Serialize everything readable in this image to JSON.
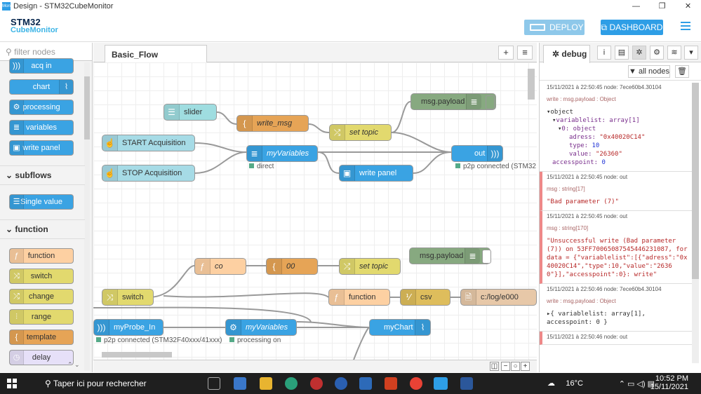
{
  "window": {
    "title": "Design - STM32CubeMonitor",
    "icon": "Mon"
  },
  "header": {
    "logo_line1": "STM32",
    "logo_line2": "CubeMonitor",
    "deploy_label": "DEPLOY",
    "dashboard_label": "DASHBOARD",
    "colors": {
      "accent": "#2e9ee6",
      "deploy_disabled": "#8ec8ea"
    }
  },
  "palette": {
    "filter_placeholder": "filter nodes",
    "nodes_top": [
      {
        "label": "acq in"
      },
      {
        "label": "chart"
      },
      {
        "label": "processing"
      },
      {
        "label": "variables"
      },
      {
        "label": "write panel"
      }
    ],
    "cat_subflows": "subflows",
    "subflow_nodes": [
      {
        "label": "Single value"
      }
    ],
    "cat_function": "function",
    "function_nodes": [
      {
        "label": "function"
      },
      {
        "label": "switch"
      },
      {
        "label": "change"
      },
      {
        "label": "range"
      },
      {
        "label": "template"
      },
      {
        "label": "delay"
      }
    ]
  },
  "workspace": {
    "tab_label": "Basic_Flow",
    "add_icon": "+",
    "list_icon": "≡"
  },
  "flow_nodes": {
    "slider": "slider",
    "write_msg": "write_msg",
    "set_topic1": "set topic",
    "msg_payload1": "msg.payload",
    "start": "START Acquisition",
    "stop": "STOP Acquisition",
    "myvariables1": "myVariables",
    "myvariables1_status": "direct",
    "write_panel": "write panel",
    "out": "out",
    "out_status": "p2p connected (STM32",
    "co": "co",
    "oo": "00",
    "set_topic2": "set topic",
    "msg_payload2": "msg.payload",
    "switch": "switch",
    "function": "function",
    "csv": "csv",
    "file": "c:/log/e000",
    "myprobe_in": "myProbe_In",
    "myprobe_status": "p2p connected (STM32F40xxx/41xxx)",
    "myvariables2": "myVariables",
    "myvariables2_status": "processing on",
    "mychart": "myChart"
  },
  "sidebar": {
    "tab_label": "debug",
    "allnodes_label": "all nodes",
    "messages": [
      {
        "meta": "15/11/2021 à 22:50:45   node: 7ece60b4.30104",
        "topic": "write : msg.payload : Object",
        "kind": "tree",
        "l1": "object",
        "l2": "variablelist: array[1]",
        "l3": "0: object",
        "adress_k": "adress:",
        "adress_v": "\"0x40020C14\"",
        "type_k": "type:",
        "type_v": "10",
        "value_k": "value:",
        "value_v": "\"26360\"",
        "acc_k": "accesspoint:",
        "acc_v": "0"
      },
      {
        "meta": "15/11/2021 à 22:50:45   node: out",
        "topic": "msg : string[17]",
        "body": "\"Bad parameter (7)\""
      },
      {
        "meta": "15/11/2021 à 22:50:45   node: out",
        "topic": "msg : string[170]",
        "body": "\"Unsuccessful write (Bad parameter (7)) on 53FF70065087545446231087, for data = {\"variablelist\":[{\"adress\":\"0x40020C14\",\"type\":10,\"value\":\"26360\"}],\"accesspoint\":0}: write\""
      },
      {
        "meta": "15/11/2021 à 22:50:46   node: 7ece60b4.30104",
        "topic": "write : msg.payload : Object",
        "body": "▸{ variablelist: array[1], accesspoint: 0 }"
      },
      {
        "meta": "15/11/2021 à 22:50:46   node: out",
        "topic": "",
        "body": ""
      }
    ]
  },
  "taskbar": {
    "search_placeholder": "Taper ici pour rechercher",
    "temperature": "16°C",
    "time": "10:52 PM",
    "date": "15/11/2021"
  }
}
